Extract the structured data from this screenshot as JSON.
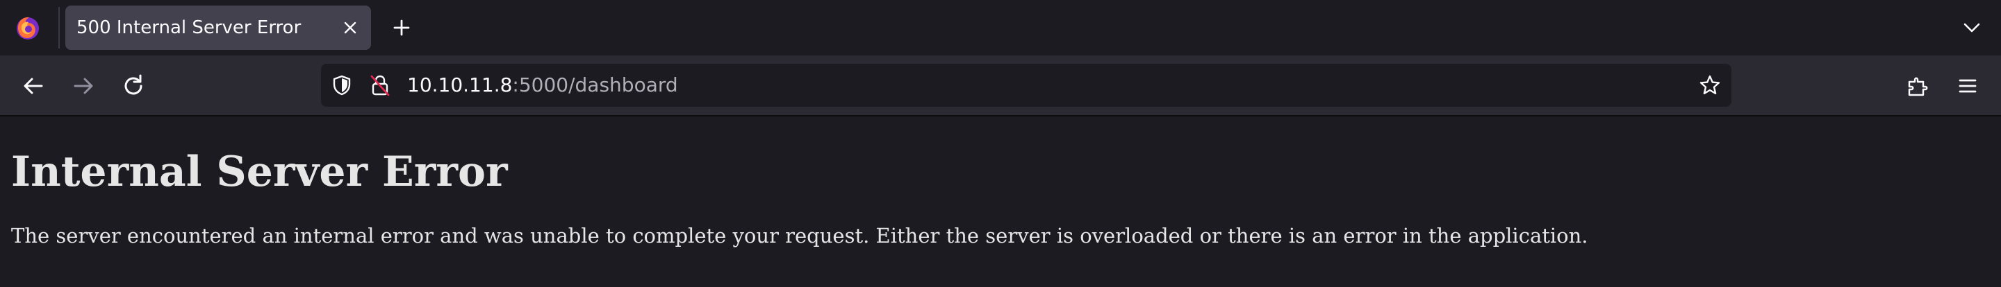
{
  "browser": {
    "tab": {
      "title": "500 Internal Server Error"
    },
    "address_bar": {
      "host": "10.10.11.8",
      "rest": ":5000/dashboard"
    },
    "icons": {
      "app": "firefox-icon",
      "tab_close": "close-icon",
      "new_tab": "plus-icon",
      "tab_list": "chevron-down-icon",
      "back": "arrow-left-icon",
      "forward": "arrow-right-icon",
      "reload": "reload-icon",
      "tracking_protection": "shield-icon",
      "connection": "insecure-lock-icon",
      "bookmark": "star-icon",
      "extensions": "puzzle-icon",
      "menu": "hamburger-menu-icon"
    },
    "colors": {
      "chrome_bg": "#1c1b22",
      "toolbar_bg": "#2b2a33",
      "active_tab_bg": "#42414d",
      "insecure_slash": "#e22850"
    }
  },
  "page": {
    "heading": "Internal Server Error",
    "message": "The server encountered an internal error and was unable to complete your request. Either the server is overloaded or there is an error in the application."
  }
}
